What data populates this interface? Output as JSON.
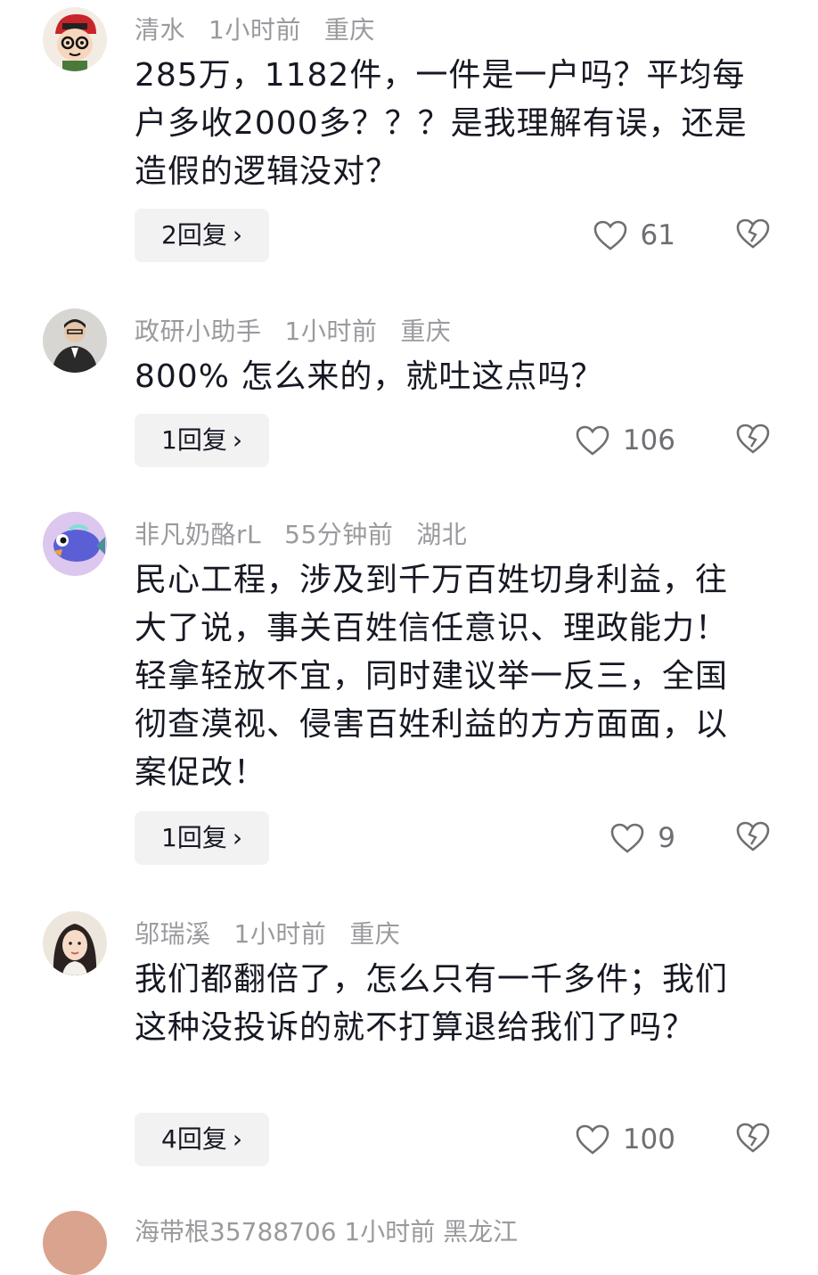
{
  "comments": [
    {
      "username": "清水",
      "time": "1小时前",
      "location": "重庆",
      "text": "285万，1182件，一件是一户吗？平均每户多收2000多？？？是我理解有误，还是造假的逻辑没对？",
      "reply_label": "2回复",
      "likes": "61"
    },
    {
      "username": "政研小助手",
      "time": "1小时前",
      "location": "重庆",
      "text": "800% 怎么来的，就吐这点吗？",
      "reply_label": "1回复",
      "likes": "106"
    },
    {
      "username": "非凡奶酪rL",
      "time": "55分钟前",
      "location": "湖北",
      "text": "民心工程，涉及到千万百姓切身利益，往大了说，事关百姓信任意识、理政能力！轻拿轻放不宜，同时建议举一反三，全国彻查漠视、侵害百姓利益的方方面面，以案促改！",
      "reply_label": "1回复",
      "likes": "9"
    },
    {
      "username": "邬瑞溪",
      "time": "1小时前",
      "location": "重庆",
      "text": "我们都翻倍了，怎么只有一千多件；我们这种没投诉的就不打算退给我们了吗？",
      "reply_label": "4回复",
      "likes": "100"
    }
  ],
  "next_comment_partial": {
    "meta": "海带根35788706  1小时前  黑龙江"
  },
  "icons": {
    "like": "heart-outline-icon",
    "dislike": "broken-heart-icon",
    "reply_chevron": "chevron-right-icon"
  },
  "colors": {
    "meta_gray": "#9a9a9e",
    "text": "#161823",
    "reply_bg": "#f2f2f3"
  }
}
